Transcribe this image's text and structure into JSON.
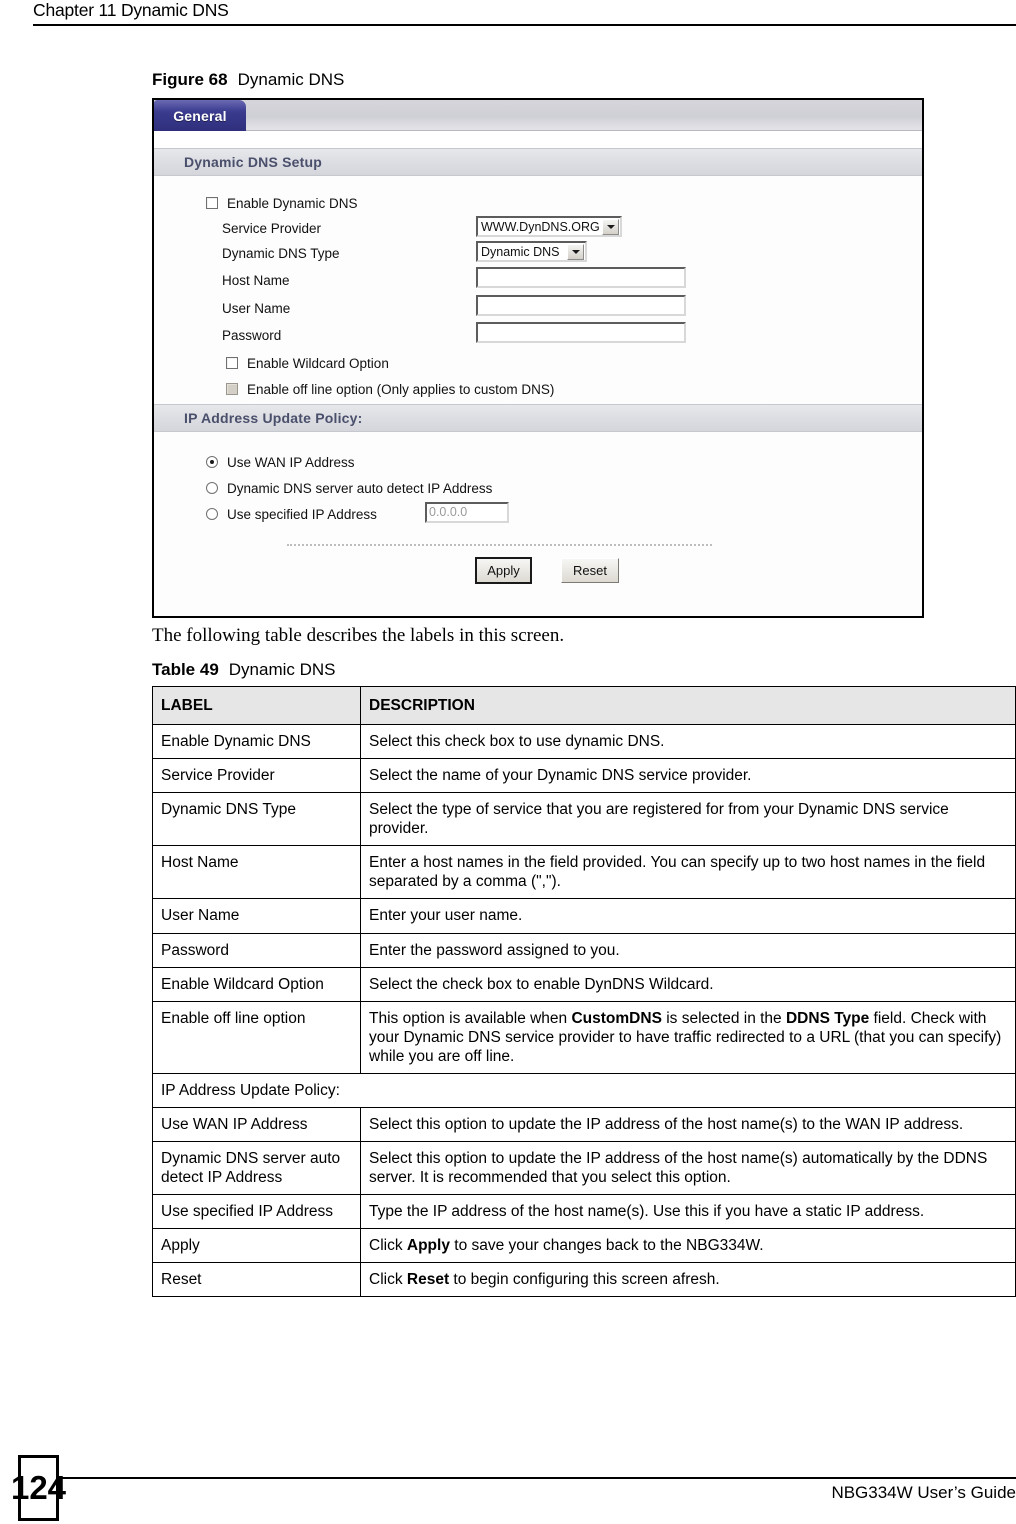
{
  "header": {
    "chapter": "Chapter 11 Dynamic DNS"
  },
  "figure": {
    "caption_label": "Figure 68",
    "caption_title": "Dynamic DNS",
    "tab_label": "General",
    "section_setup_title": "Dynamic DNS Setup",
    "section_policy_title": "IP Address Update Policy:",
    "enable_ddns_label": "Enable Dynamic DNS",
    "service_provider_label": "Service Provider",
    "service_provider_value": "WWW.DynDNS.ORG",
    "ddns_type_label": "Dynamic DNS Type",
    "ddns_type_value": "Dynamic DNS",
    "host_name_label": "Host Name",
    "host_name_value": "",
    "user_name_label": "User Name",
    "user_name_value": "",
    "password_label": "Password",
    "password_value": "",
    "wildcard_label": "Enable Wildcard Option",
    "offline_label": "Enable off line option (Only applies to custom DNS)",
    "radio_wan_label": "Use WAN IP Address",
    "radio_auto_label": "Dynamic DNS server auto detect IP Address",
    "radio_specified_label": "Use specified IP Address",
    "specified_ip_value": "0.0.0.0",
    "apply_label": "Apply",
    "reset_label": "Reset",
    "tab_color": "#3b3b8f"
  },
  "intro": {
    "text": "The following table describes the labels in this screen."
  },
  "table": {
    "caption_label": "Table 49",
    "caption_title": "Dynamic DNS",
    "columns": [
      "LABEL",
      "DESCRIPTION"
    ],
    "rows": [
      {
        "label": "Enable Dynamic DNS",
        "desc_html": "Select this check box to use dynamic DNS."
      },
      {
        "label": "Service Provider",
        "desc_html": "Select the name of your Dynamic DNS service provider."
      },
      {
        "label": "Dynamic DNS Type",
        "desc_html": "Select the type of service that you are registered for from your Dynamic DNS service provider."
      },
      {
        "label": "Host Name",
        "desc_html": "Enter a host names in the field provided. You can specify up to two host names in the field separated by a comma (\",\")."
      },
      {
        "label": "User Name",
        "desc_html": "Enter your user name."
      },
      {
        "label": "Password",
        "desc_html": "Enter the password assigned to you."
      },
      {
        "label": "Enable Wildcard Option",
        "desc_html": "Select the check box to enable DynDNS Wildcard."
      },
      {
        "label": "Enable off line option",
        "desc_html": "This option is available when <b>CustomDNS</b> is selected in the <b>DDNS Type</b> field. Check with your Dynamic DNS service provider to have traffic redirected to a URL (that you can specify) while you are off line."
      },
      {
        "label": "IP Address Update Policy:",
        "desc_html": "",
        "span": true
      },
      {
        "label": "Use WAN IP Address",
        "desc_html": "Select this option to update the IP address of the host name(s) to the WAN IP address."
      },
      {
        "label": "Dynamic DNS server auto detect IP Address",
        "desc_html": "Select this option to update the IP address of the host name(s) automatically by the DDNS server. It is recommended that you select this option."
      },
      {
        "label": "Use specified IP Address",
        "desc_html": "Type the IP address of the host name(s). Use this if you have a static IP address."
      },
      {
        "label": "Apply",
        "desc_html": "Click <b>Apply</b> to save your changes back to the NBG334W."
      },
      {
        "label": "Reset",
        "desc_html": "Click <b>Reset</b> to begin configuring this screen afresh."
      }
    ]
  },
  "footer": {
    "page_number": "124",
    "guide_title": "NBG334W User’s Guide"
  }
}
